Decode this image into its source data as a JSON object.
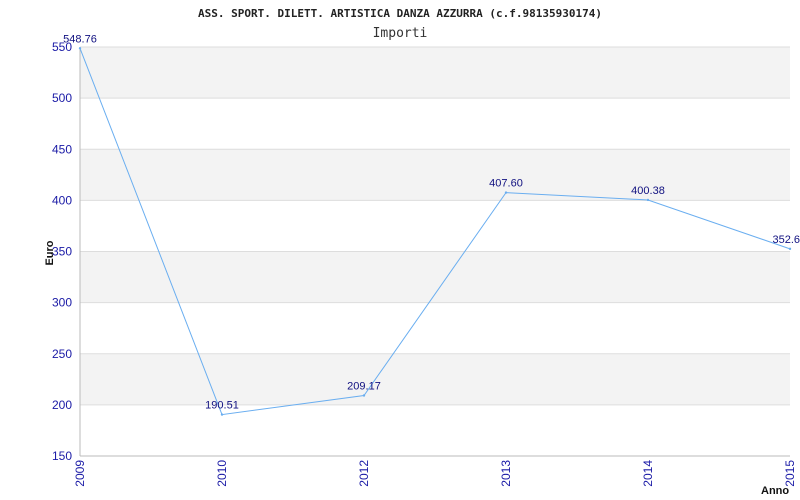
{
  "chart_data": {
    "type": "line",
    "title": "ASS. SPORT. DILETT. ARTISTICA DANZA AZZURRA (c.f.98135930174)",
    "subtitle": "Importi",
    "xlabel": "Anno",
    "ylabel": "Euro",
    "categories": [
      "2009",
      "2010",
      "2012",
      "2013",
      "2014",
      "2015"
    ],
    "values": [
      548.76,
      190.51,
      209.17,
      407.6,
      400.38,
      352.6
    ],
    "data_labels": [
      "548.76",
      "190.51",
      "209.17",
      "407.60",
      "400.38",
      "352.6"
    ],
    "yticks": [
      "150",
      "200",
      "250",
      "300",
      "350",
      "400",
      "450",
      "500",
      "550"
    ],
    "ylim": [
      150,
      550
    ],
    "grid": true,
    "colors": {
      "line": "#6aaef0",
      "band": "#f3f3f3",
      "tick_text": "#1a1aa6",
      "label_text": "#101080"
    }
  }
}
